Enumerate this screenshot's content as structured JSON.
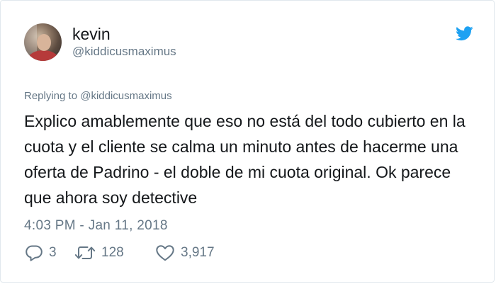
{
  "tweet": {
    "author": {
      "name": "kevin",
      "handle": "@kiddicusmaximus"
    },
    "replying_to": "Replying to @kiddicusmaximus",
    "text": "Explico amablemente que eso no está del todo cubierto en la cuota y el cliente se calma un minuto antes de hacerme una oferta de Padrino - el doble de mi cuota original. Ok parece que ahora soy detective",
    "timestamp": "4:03 PM - Jan 11, 2018",
    "actions": {
      "reply_count": "3",
      "retweet_count": "128",
      "like_count": "3,917"
    }
  },
  "icons": {
    "brand": "twitter-bird-icon",
    "reply": "reply-bubble-icon",
    "retweet": "retweet-arrows-icon",
    "like": "heart-icon"
  },
  "colors": {
    "brand_blue": "#1da1f2",
    "secondary_text": "#657786",
    "primary_text": "#14171a",
    "border": "#e1e8ed"
  }
}
